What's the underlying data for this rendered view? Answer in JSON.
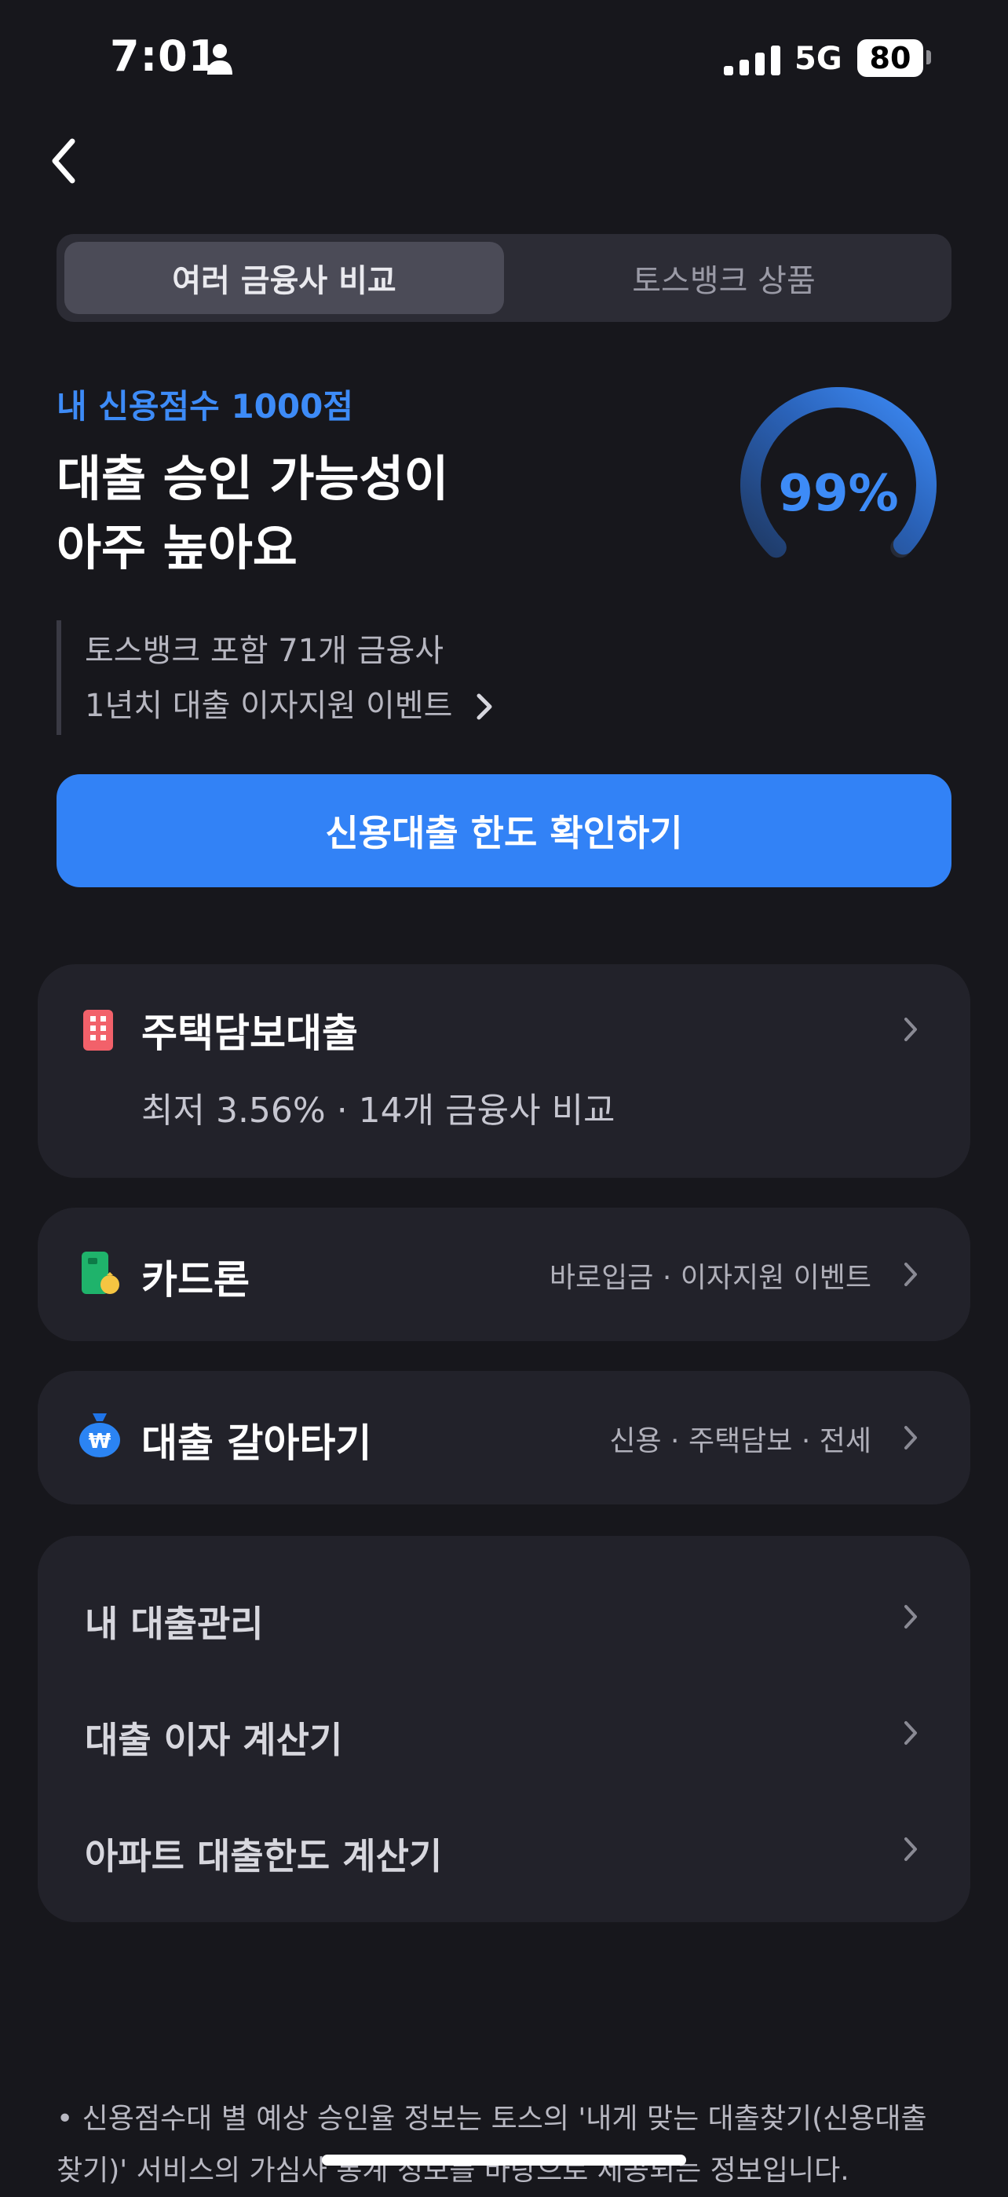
{
  "status": {
    "time": "7:01",
    "network": "5G",
    "battery": "80"
  },
  "tabs": {
    "active": "여러 금융사 비교",
    "inactive": "토스뱅크 상품"
  },
  "hero": {
    "credit_label": "내 신용점수 1000점",
    "headline_line1": "대출 승인 가능성이",
    "headline_line2": "아주 높아요",
    "probability": "99%",
    "probability_fraction": 0.99,
    "info_line1": "토스뱅크 포함 71개 금융사",
    "info_line2": "1년치 대출 이자지원 이벤트"
  },
  "cta": {
    "label": "신용대출 한도 확인하기",
    "color": "#3282f6"
  },
  "cards": {
    "mortgage": {
      "title": "주택담보대출",
      "subtitle": "최저 3.56% · 14개 금융사 비교",
      "icon": "building-icon"
    },
    "card_loan": {
      "title": "카드론",
      "right": "바로입금 · 이자지원 이벤트",
      "icon": "card-coin-icon"
    },
    "refinance": {
      "title": "대출 갈아타기",
      "right": "신용 · 주택담보 · 전세",
      "icon": "money-bag-icon"
    }
  },
  "menu": {
    "items": [
      {
        "label": "내 대출관리"
      },
      {
        "label": "대출 이자 계산기"
      },
      {
        "label": "아파트 대출한도 계산기"
      }
    ]
  },
  "footer": {
    "line1": "• 신용점수대 별 예상 승인율 정보는 토스의 '내게 맞는 대출찾기(신용대출",
    "line2": "찾기)' 서비스의 가심사 통계 정보를 바탕으로 제공되는 정보입니다."
  },
  "colors": {
    "background": "#17171c",
    "accent": "#3d8bf7",
    "card": "#22222a"
  }
}
